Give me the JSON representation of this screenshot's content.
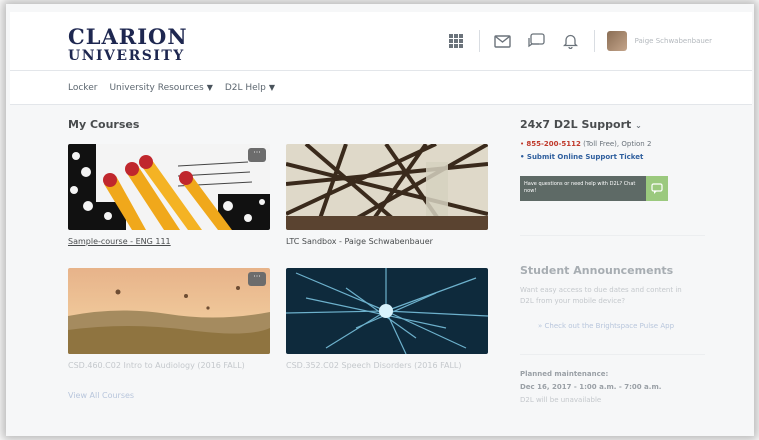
{
  "header": {
    "logo_line1": "CLARION",
    "logo_line2": "UNIVERSITY",
    "icons": [
      "grid-icon",
      "mail-icon",
      "chat-icon",
      "bell-icon"
    ],
    "user_name": "Paige Schwabenbauer"
  },
  "nav": {
    "items": [
      {
        "label": "Locker",
        "dropdown": false
      },
      {
        "label": "University Resources",
        "dropdown": true
      },
      {
        "label": "D2L Help",
        "dropdown": true
      }
    ]
  },
  "courses": {
    "title": "My Courses",
    "items": [
      {
        "name": "Sample-course - ENG 111",
        "image": "pencils"
      },
      {
        "name": "LTC Sandbox - Paige Schwabenbauer",
        "image": "bridge"
      },
      {
        "name": "CSD.460.C02 Intro to Audiology (2016 FALL)",
        "image": "balloons"
      },
      {
        "name": "CSD.352.C02 Speech Disorders (2016 FALL)",
        "image": "neurons"
      }
    ],
    "view_all": "View All Courses"
  },
  "support": {
    "title": "24x7 D2L Support",
    "phone_prefix": "• ",
    "phone": "855-200-5112",
    "phone_suffix": " (Toll Free), Option 2",
    "ticket": "• Submit Online Support Ticket",
    "chat_text": "Have questions or need help with D2L? Chat now!"
  },
  "announcements": {
    "title": "Student Announcements",
    "line1": "Want easy access to due dates and content in",
    "line2": "D2L from your mobile device?",
    "link": "» Check out the Brightspace Pulse App",
    "maint_title": "Planned maintenance:",
    "maint_date": "Dec 16, 2017 - 1:00 a.m. - 7:00 a.m.",
    "maint_note": "D2L will be unavailable"
  },
  "colors": {
    "brand_navy": "#1e2750",
    "link_blue": "#2f5f9e",
    "support_red": "#c0392b",
    "chat_green": "#9bc97e"
  }
}
